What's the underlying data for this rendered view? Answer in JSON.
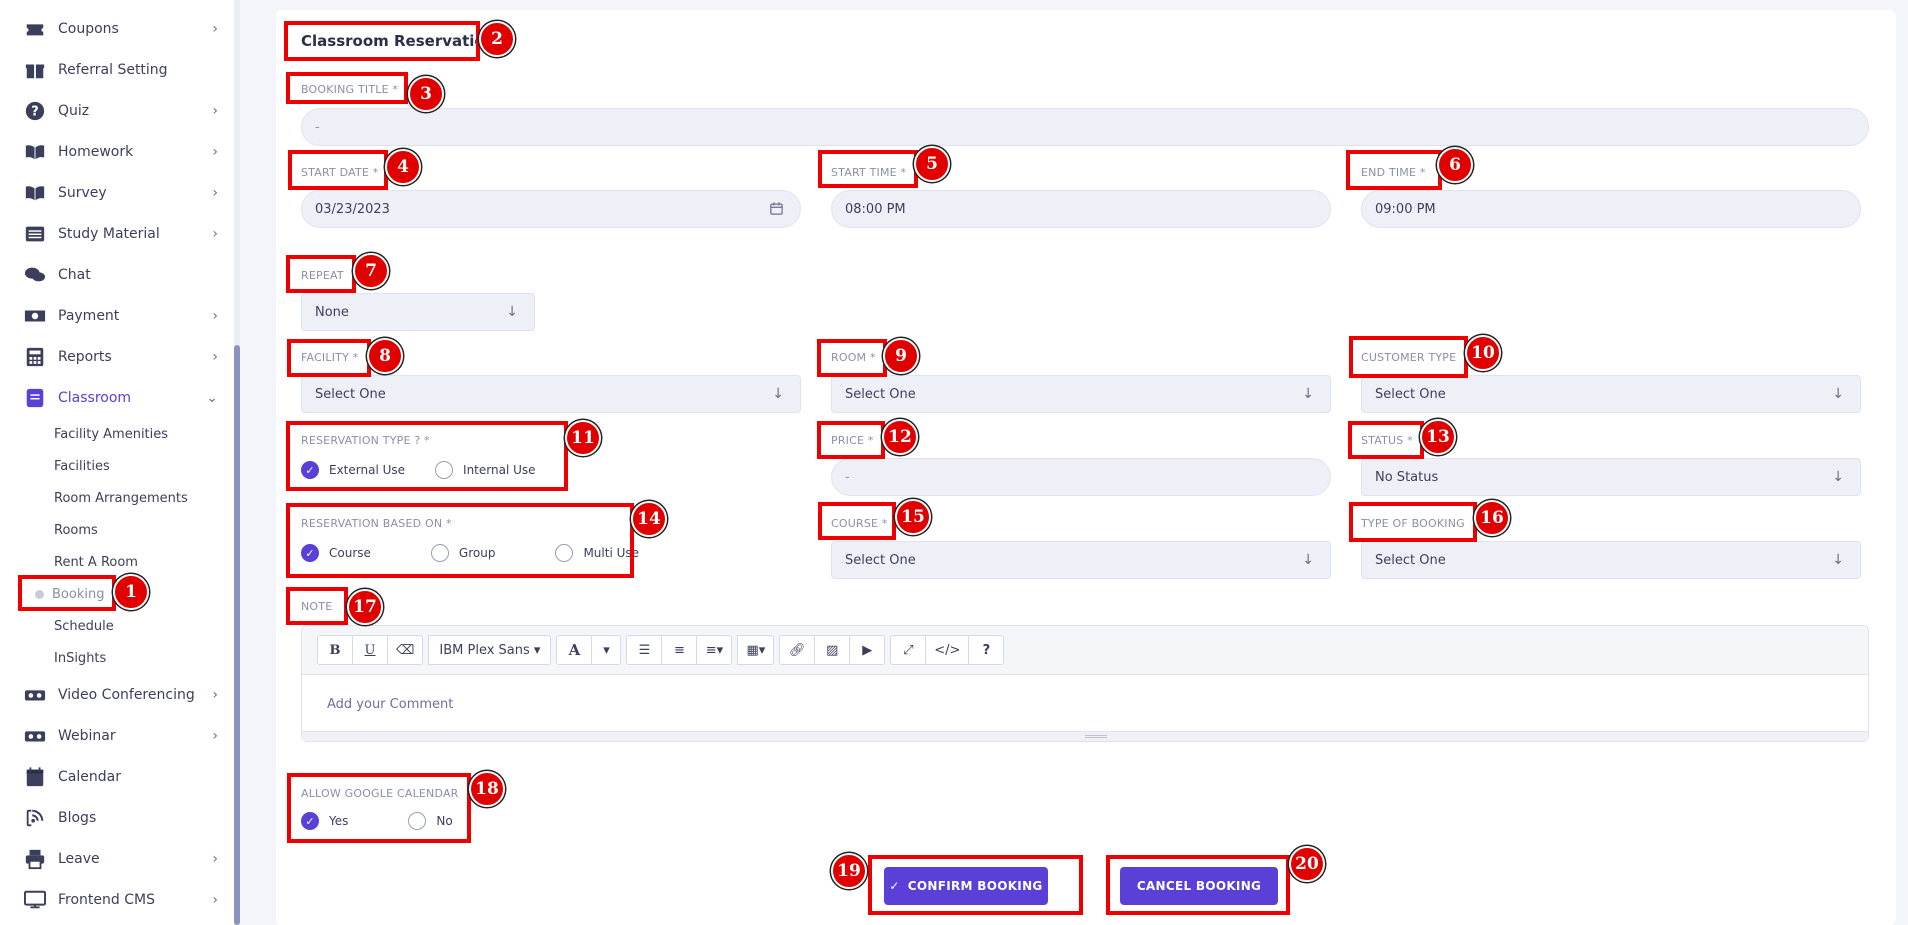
{
  "sidebar": {
    "items": [
      {
        "label": "Coupons",
        "icon": "tag-icon",
        "chevron": "›"
      },
      {
        "label": "Referral Setting",
        "icon": "gift-icon",
        "chevron": ""
      },
      {
        "label": "Quiz",
        "icon": "question-icon",
        "chevron": "›"
      },
      {
        "label": "Homework",
        "icon": "book-icon",
        "chevron": "›"
      },
      {
        "label": "Survey",
        "icon": "book-open-icon",
        "chevron": "›"
      },
      {
        "label": "Study Material",
        "icon": "list-icon",
        "chevron": "›"
      },
      {
        "label": "Chat",
        "icon": "chat-icon",
        "chevron": ""
      },
      {
        "label": "Payment",
        "icon": "money-icon",
        "chevron": "›"
      },
      {
        "label": "Reports",
        "icon": "calculator-icon",
        "chevron": "›"
      },
      {
        "label": "Classroom",
        "icon": "classroom-icon",
        "chevron": "⌄"
      }
    ],
    "classroom_sub": [
      "Facility Amenities",
      "Facilities",
      "Room Arrangements",
      "Rooms",
      "Rent A Room",
      "Booking",
      "Schedule",
      "InSights"
    ],
    "items_after": [
      {
        "label": "Video Conferencing",
        "icon": "vr-icon",
        "chevron": "›"
      },
      {
        "label": "Webinar",
        "icon": "vr-icon",
        "chevron": "›"
      },
      {
        "label": "Calendar",
        "icon": "calendar-icon",
        "chevron": ""
      },
      {
        "label": "Blogs",
        "icon": "blog-icon",
        "chevron": ""
      },
      {
        "label": "Leave",
        "icon": "print-icon",
        "chevron": "›"
      },
      {
        "label": "Frontend CMS",
        "icon": "monitor-icon",
        "chevron": "›"
      }
    ]
  },
  "form": {
    "title": "Classroom Reservation",
    "booking_title_label": "BOOKING TITLE *",
    "booking_title_value": "-",
    "start_date_label": "START DATE *",
    "start_date_value": "03/23/2023",
    "start_time_label": "START TIME *",
    "start_time_value": "08:00 PM",
    "end_time_label": "END TIME *",
    "end_time_value": "09:00 PM",
    "repeat_label": "REPEAT",
    "repeat_value": "None",
    "facility_label": "FACILITY *",
    "facility_value": "Select One",
    "room_label": "ROOM *",
    "room_value": "Select One",
    "customer_type_label": "CUSTOMER TYPE",
    "customer_type_value": "Select One",
    "reservation_type_label": "RESERVATION TYPE ? *",
    "reservation_type_options": [
      "External Use",
      "Internal Use"
    ],
    "price_label": "PRICE *",
    "price_value": "-",
    "status_label": "STATUS *",
    "status_value": "No Status",
    "based_on_label": "RESERVATION BASED ON *",
    "based_on_options": [
      "Course",
      "Group",
      "Multi Use"
    ],
    "course_label": "COURSE *",
    "course_value": "Select One",
    "type_of_booking_label": "TYPE OF BOOKING",
    "type_of_booking_value": "Select One",
    "note_label": "NOTE",
    "note_placeholder": "Add your Comment",
    "editor_font": "IBM Plex Sans",
    "google_label": "ALLOW GOOGLE CALENDAR",
    "google_options": [
      "Yes",
      "No"
    ],
    "confirm_label": "CONFIRM BOOKING",
    "cancel_label": "CANCEL BOOKING"
  },
  "markers": [
    "1",
    "2",
    "3",
    "4",
    "5",
    "6",
    "7",
    "8",
    "9",
    "10",
    "11",
    "12",
    "13",
    "14",
    "15",
    "16",
    "17",
    "18",
    "19",
    "20"
  ],
  "colors": {
    "accent": "#5b3fd6",
    "marker": "#e00000"
  }
}
